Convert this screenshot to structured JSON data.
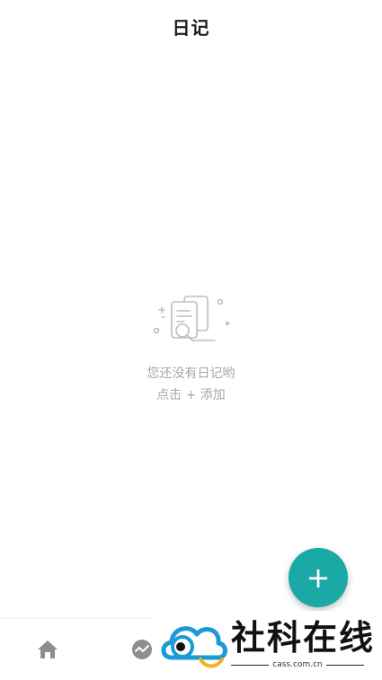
{
  "header": {
    "title": "日记"
  },
  "empty_state": {
    "icon": "document-search-illustration",
    "line1": "您还没有日记哟",
    "line2": "点击 + 添加"
  },
  "fab": {
    "label": "+",
    "icon": "plus-icon",
    "color": "#1aa9a5"
  },
  "tabbar": {
    "items": [
      {
        "name": "home",
        "icon": "home-icon"
      },
      {
        "name": "stats",
        "icon": "chart-circle-icon"
      }
    ]
  },
  "watermark": {
    "brand": "社科在线",
    "domain": "cass.com.cn"
  }
}
